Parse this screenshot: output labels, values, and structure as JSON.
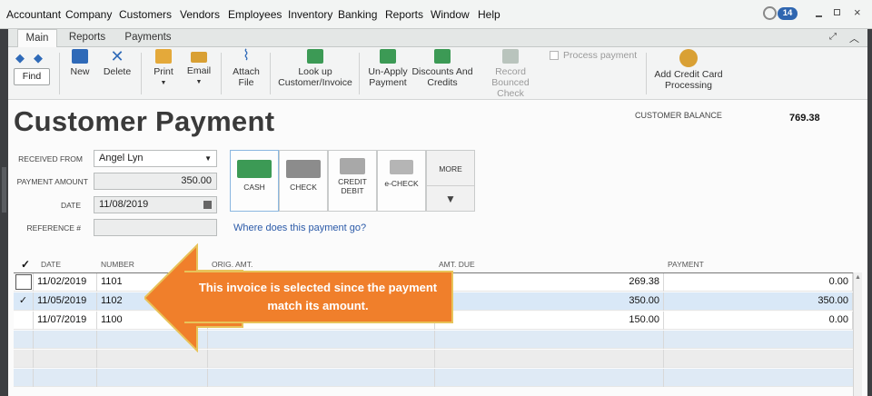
{
  "menu": [
    "Accountant",
    "Company",
    "Customers",
    "Vendors",
    "Employees",
    "Inventory",
    "Banking",
    "Reports",
    "Window",
    "Help"
  ],
  "menu_badge": "14",
  "tabs": [
    "Main",
    "Reports",
    "Payments"
  ],
  "toolbar": {
    "find": "Find",
    "new": "New",
    "delete": "Delete",
    "print": "Print",
    "email": "Email",
    "attach_1": "Attach",
    "attach_2": "File",
    "lookup_1": "Look up",
    "lookup_2": "Customer/Invoice",
    "unapply_1": "Un-Apply",
    "unapply_2": "Payment",
    "discounts_1": "Discounts And",
    "discounts_2": "Credits",
    "record_1": "Record",
    "record_2": "Bounced Check",
    "process_payment": "Process payment",
    "addcc_1": "Add Credit Card",
    "addcc_2": "Processing"
  },
  "form": {
    "title": "Customer Payment",
    "customer_balance_label": "CUSTOMER BALANCE",
    "customer_balance": "769.38",
    "received_from_label": "RECEIVED FROM",
    "received_from": "Angel Lyn",
    "payment_amount_label": "PAYMENT AMOUNT",
    "payment_amount": "350.00",
    "date_label": "DATE",
    "date": "11/08/2019",
    "reference_label": "REFERENCE #",
    "reference": "",
    "where_link": "Where does this payment go?"
  },
  "payment_methods": {
    "cash": "CASH",
    "check": "CHECK",
    "credit_1": "CREDIT",
    "credit_2": "DEBIT",
    "echeck": "e-CHECK",
    "more": "MORE"
  },
  "grid": {
    "headers": {
      "check": "✓",
      "date": "DATE",
      "number": "NUMBER",
      "orig": "ORIG. AMT.",
      "due": "AMT. DUE",
      "payment": "PAYMENT"
    },
    "rows": [
      {
        "check": "",
        "date": "11/02/2019",
        "number": "1101",
        "orig": "",
        "due": "269.38",
        "payment": "0.00"
      },
      {
        "check": "✓",
        "date": "11/05/2019",
        "number": "1102",
        "orig": "",
        "due": "350.00",
        "payment": "350.00"
      },
      {
        "check": "",
        "date": "11/07/2019",
        "number": "1100",
        "orig": "",
        "due": "150.00",
        "payment": "0.00"
      }
    ]
  },
  "callout": {
    "line1": "This invoice is selected since the payment",
    "line2": "match its amount."
  },
  "colors": {
    "accent_blue": "#2b5aa8",
    "callout": "#f07f2b",
    "callout_border": "#e8c35a",
    "selected_row": "#d9e8f7"
  }
}
